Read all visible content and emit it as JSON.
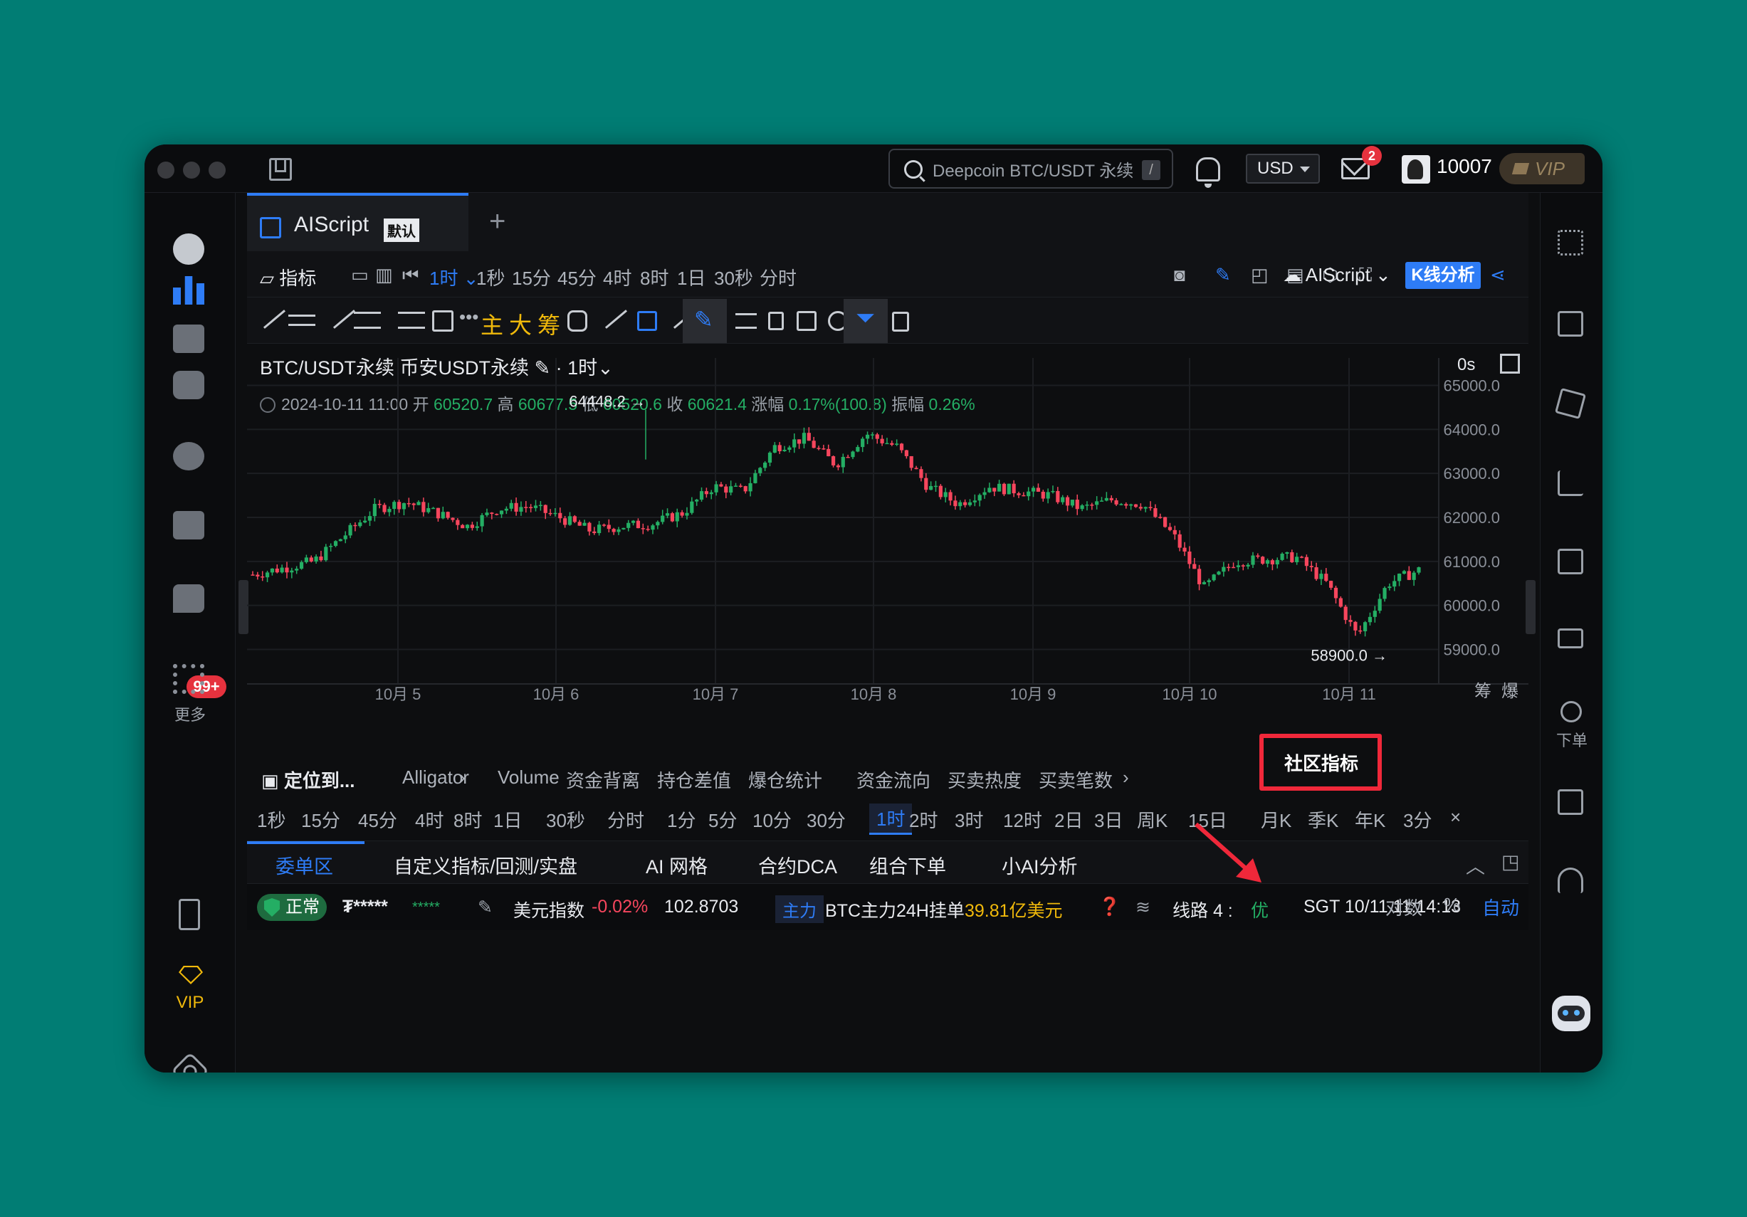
{
  "window": {
    "search_placeholder": "Deepcoin BTC/USDT 永续",
    "search_shortcut": "/",
    "currency": "USD",
    "mail_badge": "2",
    "uid": "10007",
    "vip_label": "VIP"
  },
  "left_sidebar": {
    "chat_badge": "99+",
    "more_label": "更多",
    "vip_label": "VIP"
  },
  "tab": {
    "name": "AIScript",
    "default_badge": "默认",
    "add": "+"
  },
  "toolbar1": {
    "indicators": "指标",
    "active_interval": "1时",
    "intervals": [
      "1秒",
      "15分",
      "45分",
      "4时",
      "8时",
      "1日",
      "30秒",
      "分时"
    ],
    "script_name": "AIScript",
    "kline_button": "K线分析"
  },
  "toolbar2": {
    "text_tools": [
      "主",
      "大",
      "筹"
    ]
  },
  "chart_header": {
    "symbol": "BTC/USDT永续 币安USDT永续",
    "interval": "· 1时",
    "countdown": "0s",
    "time": "2024-10-11 11:00",
    "open_label": "开",
    "open": "60520.7",
    "high_label": "高",
    "high": "60677.5",
    "low_label": "低",
    "low": "60520.6",
    "close_label": "收",
    "close": "60621.4",
    "change_label": "涨幅",
    "change": "0.17%(100.8)",
    "amplitude_label": "振幅",
    "amplitude": "0.26%"
  },
  "chart_data": {
    "type": "candlestick",
    "title": "BTC/USDT永续 币安USDT永续",
    "y_ticks": [
      "65000.0",
      "64000.0",
      "63000.0",
      "62000.0",
      "61000.0",
      "60000.0",
      "59000.0"
    ],
    "ylim": [
      58700,
      65300
    ],
    "x_ticks": [
      "10月 5",
      "10月 6",
      "10月 7",
      "10月 8",
      "10月 9",
      "10月 10",
      "10月 11"
    ],
    "annotations": [
      {
        "label": "64448.2 →",
        "value": 64448.2
      },
      {
        "label": "58900.0 →",
        "value": 58900.0
      }
    ],
    "approx_close_path": [
      60700,
      60850,
      61000,
      61600,
      62200,
      62350,
      62100,
      61800,
      62200,
      62250,
      62000,
      61700,
      61800,
      61850,
      62100,
      62700,
      62600,
      63600,
      63800,
      63200,
      63900,
      63600,
      62700,
      62300,
      62700,
      62600,
      62500,
      62200,
      62400,
      62300,
      61600,
      60400,
      61000,
      61050,
      61100,
      60500,
      59300,
      60500,
      60800
    ]
  },
  "chart_corner": {
    "chips": "筹",
    "liq": "爆"
  },
  "indicator_bar": {
    "locate": "定位到...",
    "items": [
      "Alligator",
      "Volume",
      "资金背离",
      "持仓差值",
      "爆仓统计",
      "资金流向",
      "买卖热度",
      "买卖笔数"
    ],
    "community": "社区指标",
    "log": "对数",
    "percent": "%",
    "auto": "自动"
  },
  "timeframes": {
    "items": [
      "1秒",
      "15分",
      "45分",
      "4时",
      "8时",
      "1日",
      "30秒",
      "分时",
      "1分",
      "5分",
      "10分",
      "30分",
      "1时",
      "2时",
      "3时",
      "12时",
      "2日",
      "3日",
      "周K",
      "15日",
      "月K",
      "季K",
      "年K",
      "3分"
    ],
    "selected": "1时",
    "close": "×"
  },
  "bottom_tabs": {
    "items": [
      "委单区",
      "自定义指标/回测/实盘",
      "AI 网格",
      "合约DCA",
      "组合下单",
      "小AI分析"
    ]
  },
  "status_bar": {
    "normal": "正常",
    "masked_account": "₮*****",
    "masked_value": "*****",
    "usd_index_label": "美元指数",
    "usd_index_change": "-0.02%",
    "usd_index_value": "102.8703",
    "main_force": "主力",
    "orders_label": "BTC主力24H挂单",
    "orders_value": "39.81亿美元",
    "line_label": "线路 4 :",
    "line_quality": "优",
    "time": "SGT  10/11 11:14:13"
  },
  "right_sidebar": {
    "order_label": "下单"
  },
  "colors": {
    "up": "#24ae64",
    "down": "#f6465d",
    "accent": "#2e7cf6",
    "gold": "#f0b90b",
    "highlight": "#f0283a"
  }
}
